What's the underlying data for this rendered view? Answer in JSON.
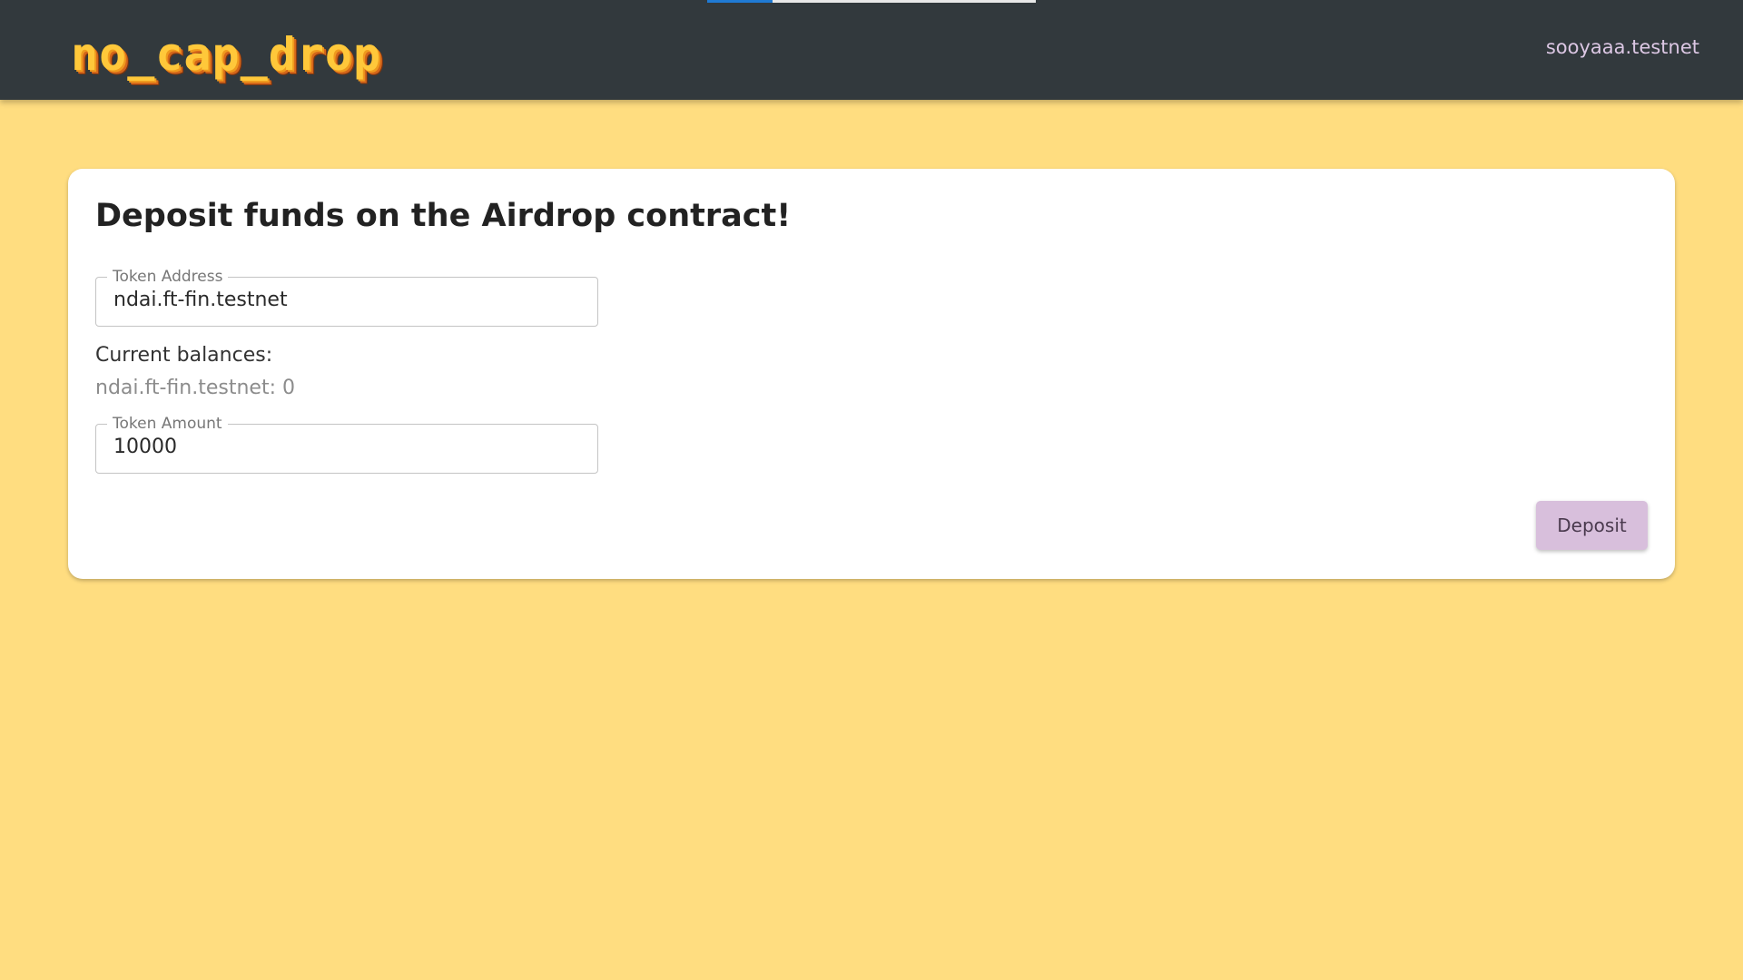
{
  "header": {
    "logo_text": "no_cap_drop",
    "account": "sooyaaa.testnet",
    "loading_progress": 0.2
  },
  "card": {
    "title": "Deposit funds on the Airdrop contract!",
    "token_address": {
      "label": "Token Address",
      "value": "ndai.ft-fin.testnet"
    },
    "balances": {
      "label": "Current balances:",
      "items": [
        {
          "token": "ndai.ft-fin.testnet",
          "amount": "0",
          "text": "ndai.ft-fin.testnet: 0"
        }
      ]
    },
    "token_amount": {
      "label": "Token Amount",
      "value": "10000"
    },
    "deposit_label": "Deposit"
  },
  "colors": {
    "page_background": "#ffdd80",
    "header_background": "#32393d",
    "progress_bar": "#1f7ad4",
    "button_background": "#d8bfdc",
    "account_text": "#dcc7e4"
  }
}
